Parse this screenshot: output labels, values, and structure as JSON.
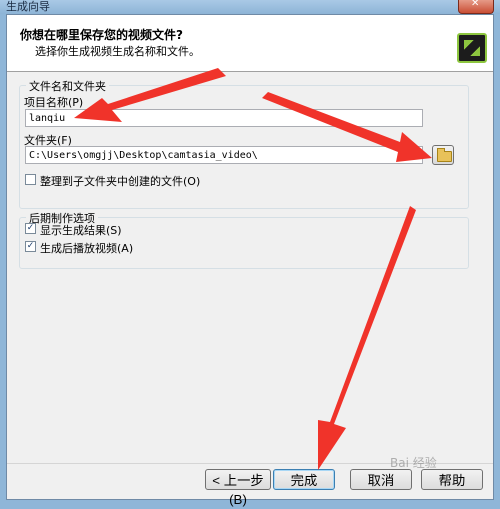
{
  "window": {
    "title": "生成向导"
  },
  "header": {
    "title": "你想在哪里保存您的视频文件?",
    "subtitle": "选择你生成视频生成名称和文件。"
  },
  "file_group": {
    "legend": "文件名和文件夹",
    "project_name_label": "项目名称(P)",
    "project_name_value": "lanqiu",
    "folder_label": "文件夹(F)",
    "folder_value": "C:\\Users\\omgjj\\Desktop\\camtasia_video\\",
    "organize_label": "整理到子文件夹中创建的文件(O)",
    "organize_checked": false
  },
  "post_group": {
    "legend": "后期制作选项",
    "show_results_label": "显示生成结果(S)",
    "show_results_checked": true,
    "play_after_label": "生成后播放视频(A)",
    "play_after_checked": true
  },
  "footer": {
    "back_label": "< 上一步(B)",
    "finish_label": "完成",
    "cancel_label": "取消",
    "help_label": "帮助"
  },
  "watermark": "Bai 经验",
  "colors": {
    "annotation": "#f0332a",
    "accent": "#3c7fb1"
  },
  "icons": {
    "logo": "camtasia-logo-icon",
    "browse": "folder-open-icon",
    "close": "close-icon"
  }
}
